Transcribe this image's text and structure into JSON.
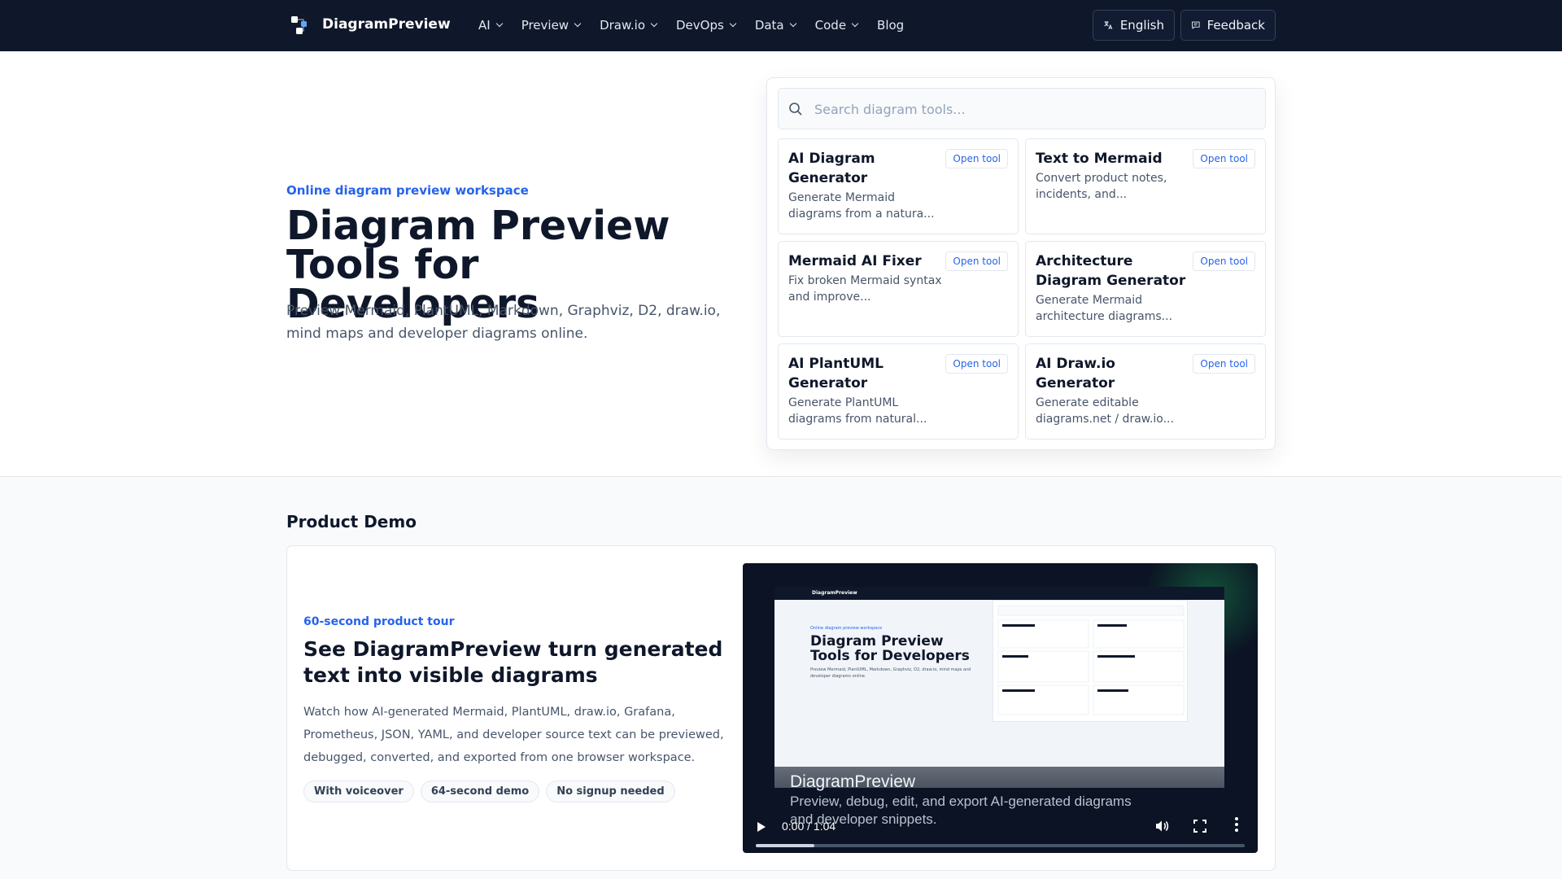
{
  "nav": {
    "brand": "DiagramPreview",
    "menu": [
      "AI",
      "Preview",
      "Draw.io",
      "DevOps",
      "Data",
      "Code",
      "Blog"
    ],
    "language": "English",
    "feedback": "Feedback"
  },
  "hero": {
    "eyebrow": "Online diagram preview workspace",
    "title": "Diagram Preview Tools for Developers",
    "subtitle": "Preview Mermaid, PlantUML, Markdown, Graphviz, D2, draw.io, mind maps and developer diagrams online."
  },
  "search": {
    "placeholder": "Search diagram tools..."
  },
  "tools": [
    {
      "title": "AI Diagram Generator",
      "desc": "Generate Mermaid diagrams from a natura...",
      "action": "Open tool"
    },
    {
      "title": "Text to Mermaid",
      "desc": "Convert product notes, incidents, and...",
      "action": "Open tool"
    },
    {
      "title": "Mermaid AI Fixer",
      "desc": "Fix broken Mermaid syntax and improve...",
      "action": "Open tool"
    },
    {
      "title": "Architecture Diagram Generator",
      "desc": "Generate Mermaid architecture diagrams...",
      "action": "Open tool"
    },
    {
      "title": "AI PlantUML Generator",
      "desc": "Generate PlantUML diagrams from natural...",
      "action": "Open tool"
    },
    {
      "title": "AI Draw.io Generator",
      "desc": "Generate editable diagrams.net / draw.io...",
      "action": "Open tool"
    }
  ],
  "demo": {
    "heading": "Product Demo",
    "eyebrow": "60-second product tour",
    "title": "See DiagramPreview turn generated text into visible diagrams",
    "desc": "Watch how AI-generated Mermaid, PlantUML, draw.io, Grafana, Prometheus, JSON, YAML, and developer source text can be previewed, debugged, converted, and exported from one browser workspace.",
    "pills": [
      "With voiceover",
      "64-second demo",
      "No signup needed"
    ]
  },
  "video": {
    "title": "DiagramPreview",
    "subtitle": "Preview, debug, edit, and export AI-generated diagrams and developer snippets.",
    "time": "0:00 / 1:04",
    "progress": 0.12,
    "thumb": {
      "nav": "DiagramPreview",
      "eyebrow": "Online diagram preview workspace",
      "title": "Diagram Preview Tools for Developers",
      "subtitle": "Preview Mermaid, PlantUML, Markdown, Graphviz, D2, draw.io, mind maps and developer diagrams online."
    }
  },
  "colors": {
    "nav_bg": "#0f172a",
    "accent": "#2563eb"
  }
}
